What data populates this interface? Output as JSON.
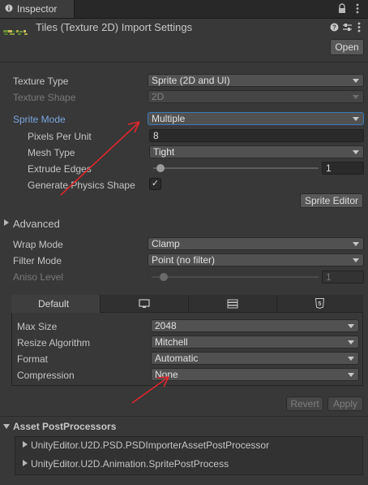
{
  "tab": {
    "label": "Inspector",
    "icon": "info-icon"
  },
  "window_controls": {
    "lock_icon": "lock-icon",
    "menu_icon": "kebab-menu-icon"
  },
  "header": {
    "title": "Tiles (Texture 2D) Import Settings",
    "open_label": "Open",
    "icons": [
      "help-icon",
      "preset-icon",
      "kebab-menu-icon"
    ]
  },
  "texture": {
    "type_label": "Texture Type",
    "type_value": "Sprite (2D and UI)",
    "shape_label": "Texture Shape",
    "shape_value": "2D",
    "sprite_mode_label": "Sprite Mode",
    "sprite_mode_value": "Multiple",
    "ppu_label": "Pixels Per Unit",
    "ppu_value": "8",
    "mesh_label": "Mesh Type",
    "mesh_value": "Tight",
    "extrude_label": "Extrude Edges",
    "extrude_value": "1",
    "extrude_level": 0.03,
    "physics_label": "Generate Physics Shape",
    "physics_checked": "✓",
    "sprite_editor_label": "Sprite Editor"
  },
  "advanced": {
    "label": "Advanced"
  },
  "sampling": {
    "wrap_label": "Wrap Mode",
    "wrap_value": "Clamp",
    "filter_label": "Filter Mode",
    "filter_value": "Point (no filter)",
    "aniso_label": "Aniso Level",
    "aniso_value": "1",
    "aniso_level": 0.06
  },
  "platform": {
    "tabs": [
      {
        "label": "Default"
      },
      {
        "icon": "monitor-icon"
      },
      {
        "icon": "server-icon"
      },
      {
        "icon": "html5-icon"
      }
    ],
    "max_size_label": "Max Size",
    "max_size_value": "2048",
    "resize_label": "Resize Algorithm",
    "resize_value": "Mitchell",
    "format_label": "Format",
    "format_value": "Automatic",
    "compression_label": "Compression",
    "compression_value": "None"
  },
  "actions": {
    "revert_label": "Revert",
    "apply_label": "Apply"
  },
  "postprocessors": {
    "title": "Asset PostProcessors",
    "items": [
      "UnityEditor.U2D.PSD.PSDImporterAssetPostProcessor",
      "UnityEditor.U2D.Animation.SpritePostProcess"
    ]
  },
  "colors": {
    "background": "#383838",
    "accent": "#3a79bb",
    "annotation": "#e0262b"
  }
}
